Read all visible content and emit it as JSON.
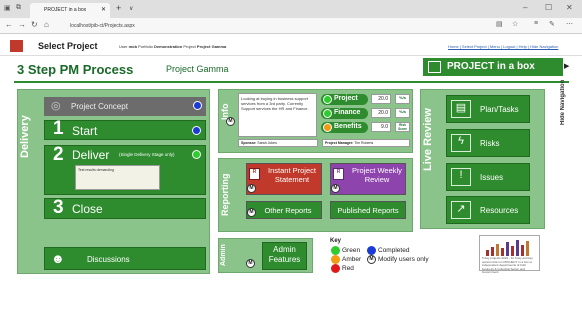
{
  "browser": {
    "tab_title": "PROJECT in a box",
    "new_tab": "+",
    "tab_chevron": "∨",
    "url": "localhost/pib-ct/Projects.aspx"
  },
  "header": {
    "title": "Select Project",
    "user_prefix": "User",
    "user": "mob",
    "portfolio_prefix": "Portfolio",
    "portfolio": "Demonstration",
    "project_prefix": "Project",
    "project": "Project Gamma",
    "links": "Home | Select Project | Menu | Logout | Help | Hide Navigation"
  },
  "page": {
    "title": "3 Step PM Process",
    "project_name": "Project Gamma",
    "brand": "PROJECT in a box",
    "hide_nav": "Hide Navigation"
  },
  "delivery": {
    "label": "Delivery",
    "concept": "Project Concept",
    "start_num": "1",
    "start": "Start",
    "deliver_num": "2",
    "deliver": "Deliver",
    "deliver_note": "(Single Delivery Stage only)",
    "notes_text": "Test results demanding",
    "close_num": "3",
    "close": "Close",
    "discussions": "Discussions",
    "colors": {
      "concept_dot": "#1a3bd6",
      "start_dot": "#1a3bd6",
      "deliver_dot": "#2ecc2e"
    }
  },
  "info": {
    "label": "Info",
    "description": "Looking at buying in business support services from a 3rd party. Currently Support services the HR and Finance.",
    "rows": [
      {
        "label": "Project",
        "value": "20.0",
        "unit": "%/s",
        "dot": "#2ecc2e"
      },
      {
        "label": "Finance",
        "value": "20.0",
        "unit": "%/s",
        "dot": "#2ecc2e"
      },
      {
        "label": "Benefits",
        "value": "9.0",
        "unit": "Risk Score",
        "dot": "#f39c12"
      }
    ],
    "sponsor_label": "Sponsor:",
    "sponsor": "Sarah Jukes",
    "manager_label": "Project Manager:",
    "manager": "Tim Roberts"
  },
  "reporting": {
    "label": "Reporting",
    "instant": "Instant Project Statement",
    "weekly": "Project Weekly Review",
    "other": "Other Reports",
    "published": "Published Reports"
  },
  "admin": {
    "label": "Admin",
    "features": "Admin Features"
  },
  "key": {
    "title": "Key",
    "green": "Green",
    "amber": "Amber",
    "red": "Red",
    "completed": "Completed",
    "modify": "Modify users only"
  },
  "live_review": {
    "label": "Live Review",
    "items": [
      "Plan/Tasks",
      "Risks",
      "Issues",
      "Resources"
    ]
  },
  "ad": {
    "text": "5 day projects 2022 - for busy and key sectors that run PROJECT in a box to independent departments of both business & Industrial Sector and Government"
  }
}
